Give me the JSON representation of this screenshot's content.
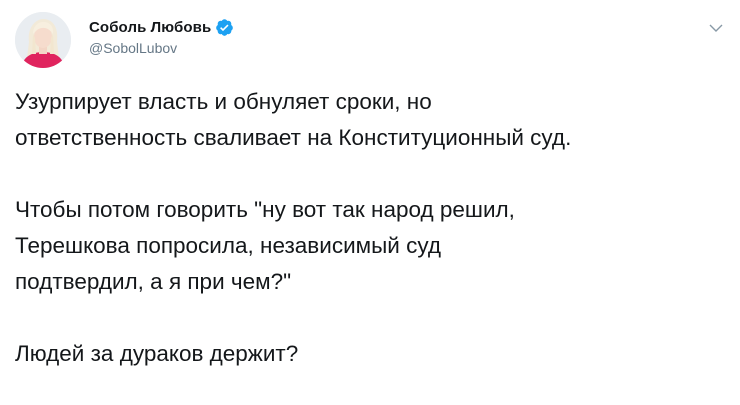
{
  "tweet": {
    "author": {
      "display_name": "Соболь Любовь",
      "handle": "@SobolLubov",
      "verified": true
    },
    "menu_icon": "chevron-down-icon",
    "paragraphs": [
      [
        "Узурпирует власть и обнуляет сроки, но",
        "ответственность сваливает на Конституционный суд."
      ],
      [
        "Чтобы потом говорить \"ну вот так народ решил,",
        "Терешкова попросила, независимый суд",
        "подтвердил, а я при чем?\""
      ],
      [
        "Людей за дураков держит?"
      ]
    ]
  },
  "colors": {
    "text": "#14171a",
    "secondary_text": "#657786",
    "verified_badge": "#1da1f2",
    "avatar_shirt": "#e0245e"
  }
}
